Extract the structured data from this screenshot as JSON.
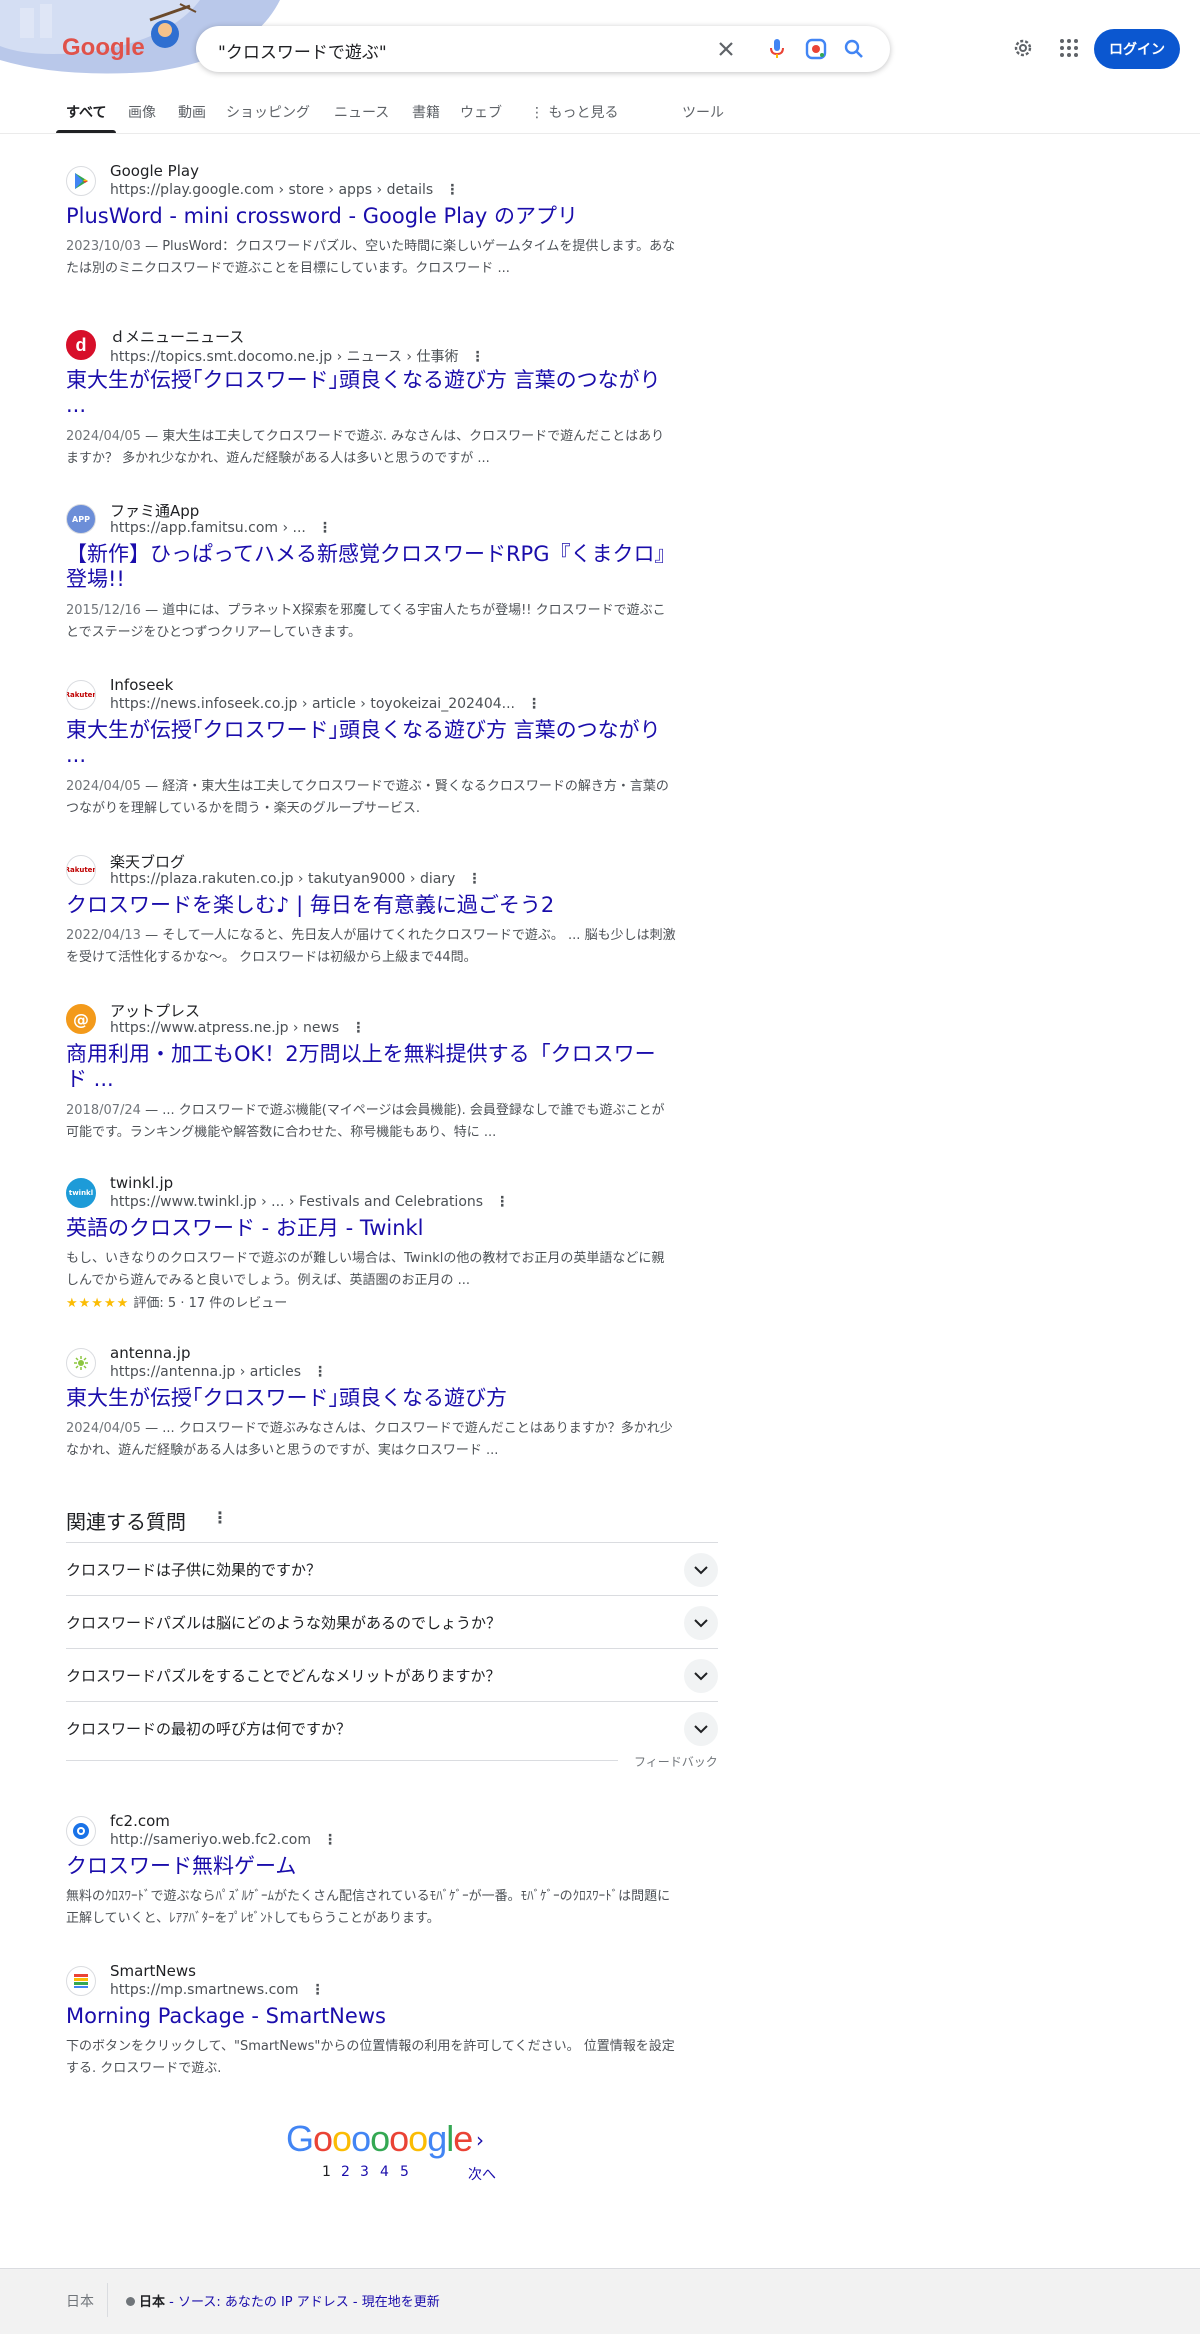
{
  "header": {
    "logo_text": "Google",
    "search_query": "\"クロスワードで遊ぶ\"",
    "login_label": "ログイン"
  },
  "tabs": [
    {
      "label": "すべて"
    },
    {
      "label": "画像"
    },
    {
      "label": "動画"
    },
    {
      "label": "ショッピング"
    },
    {
      "label": "ニュース"
    },
    {
      "label": "書籍"
    },
    {
      "label": "ウェブ"
    },
    {
      "label": "もっと見る"
    },
    {
      "label": "ツール"
    }
  ],
  "results": [
    {
      "site": "Google Play",
      "url": "https://play.google.com › store › apps › details",
      "title": "PlusWord - mini crossword - Google Play のアプリ",
      "date": "2023/10/03",
      "snippet": " — PlusWord：クロスワードパズル、空いた時間に楽しいゲームタイムを提供します。あなたは別のミニクロスワードで遊ぶことを目標にしています。クロスワード ..."
    },
    {
      "site": "ｄメニューニュース",
      "url": "https://topics.smt.docomo.ne.jp › ニュース › 仕事術",
      "title": "東大生が伝授｢クロスワード｣頭良くなる遊び方 言葉のつながり ...",
      "date": "2024/04/05",
      "snippet": " — 東大生は工夫してクロスワードで遊ぶ. みなさんは、クロスワードで遊んだことはありますか？ 多かれ少なかれ、遊んだ経験がある人は多いと思うのですが ..."
    },
    {
      "site": "ファミ通App",
      "url": "https://app.famitsu.com › ...",
      "title": "【新作】ひっぱってハメる新感覚クロスワードRPG『くまクロ』登場!!",
      "date": "2015/12/16",
      "snippet": " — 道中には、プラネットX探索を邪魔してくる宇宙人たちが登場!! クロスワードで遊ぶことでステージをひとつずつクリアーしていきます。"
    },
    {
      "site": "Infoseek",
      "url": "https://news.infoseek.co.jp › article › toyokeizai_202404...",
      "title": "東大生が伝授｢クロスワード｣頭良くなる遊び方 言葉のつながり ...",
      "date": "2024/04/05",
      "snippet": " — 経済・東大生は工夫してクロスワードで遊ぶ・賢くなるクロスワードの解き方・言葉のつながりを理解しているかを問う・楽天のグループサービス."
    },
    {
      "site": "楽天ブログ",
      "url": "https://plaza.rakuten.co.jp › takutyan9000 › diary",
      "title": "クロスワードを楽しむ♪ | 毎日を有意義に過ごそう2",
      "date": "2022/04/13",
      "snippet": " — そして一人になると、先日友人が届けてくれたクロスワードで遊ぶ。 ... 脳も少しは刺激を受けて活性化するかな〜。 クロスワードは初級から上級まで44問。"
    },
    {
      "site": "アットプレス",
      "url": "https://www.atpress.ne.jp › news",
      "title": "商用利用・加工もOK！2万問以上を無料提供する「クロスワード ...",
      "date": "2018/07/24",
      "snippet": " — ... クロスワードで遊ぶ機能(マイページは会員機能). 会員登録なしで誰でも遊ぶことが可能です。ランキング機能や解答数に合わせた、称号機能もあり、特に ..."
    },
    {
      "site": "twinkl.jp",
      "url": "https://www.twinkl.jp › ... › Festivals and Celebrations",
      "title": "英語のクロスワード - お正月 - Twinkl",
      "date": "",
      "snippet": "もし、いきなりのクロスワードで遊ぶのが難しい場合は、Twinklの他の教材でお正月の英単語などに親しんでから遊んでみると良いでしょう。例えば、英語圏のお正月の ...",
      "rating": "評価: 5 · 17 件のレビュー",
      "stars": "★★★★★"
    },
    {
      "site": "antenna.jp",
      "url": "https://antenna.jp › articles",
      "title": "東大生が伝授｢クロスワード｣頭良くなる遊び方",
      "date": "2024/04/05",
      "snippet": " — ... クロスワードで遊ぶみなさんは、クロスワードで遊んだことはありますか？多かれ少なかれ、遊んだ経験がある人は多いと思うのですが、実はクロスワード ..."
    },
    {
      "site": "fc2.com",
      "url": "http://sameriyo.web.fc2.com",
      "title": "クロスワード無料ゲーム",
      "date": "",
      "snippet": "無料のｸﾛｽﾜｰﾄﾞで遊ぶならﾊﾟｽﾞﾙｹﾞｰﾑがたくさん配信されているﾓﾊﾞｹﾞｰが一番。ﾓﾊﾞｹﾞｰのｸﾛｽﾜｰﾄﾞは問題に正解していくと、ﾚｱｱﾊﾞﾀｰをﾌﾟﾚｾﾞﾝﾄしてもらうことがあります。"
    },
    {
      "site": "SmartNews",
      "url": "https://mp.smartnews.com",
      "title": "Morning Package - SmartNews",
      "date": "",
      "snippet": "下のボタンをクリックして、\"SmartNews\"からの位置情報の利用を許可してください。 位置情報を設定する. クロスワードで遊ぶ."
    }
  ],
  "paa": {
    "title": "関連する質問",
    "questions": [
      "クロスワードは子供に効果的ですか？",
      "クロスワードパズルは脳にどのような効果があるのでしょうか？",
      "クロスワードパズルをすることでどんなメリットがありますか？",
      "クロスワードの最初の呼び方は何ですか？"
    ],
    "feedback": "フィードバック"
  },
  "pagination": {
    "logo": "Goooooogle",
    "pages": [
      "1",
      "2",
      "3",
      "4",
      "5"
    ],
    "next": "次へ"
  },
  "footer": {
    "country": "日本",
    "location": "日本",
    "source": " - ソース: あなたの IP アドレス",
    "update": " - 現在地を更新"
  },
  "colors": {
    "link": "#1a0dab",
    "login": "#0b57d0"
  }
}
